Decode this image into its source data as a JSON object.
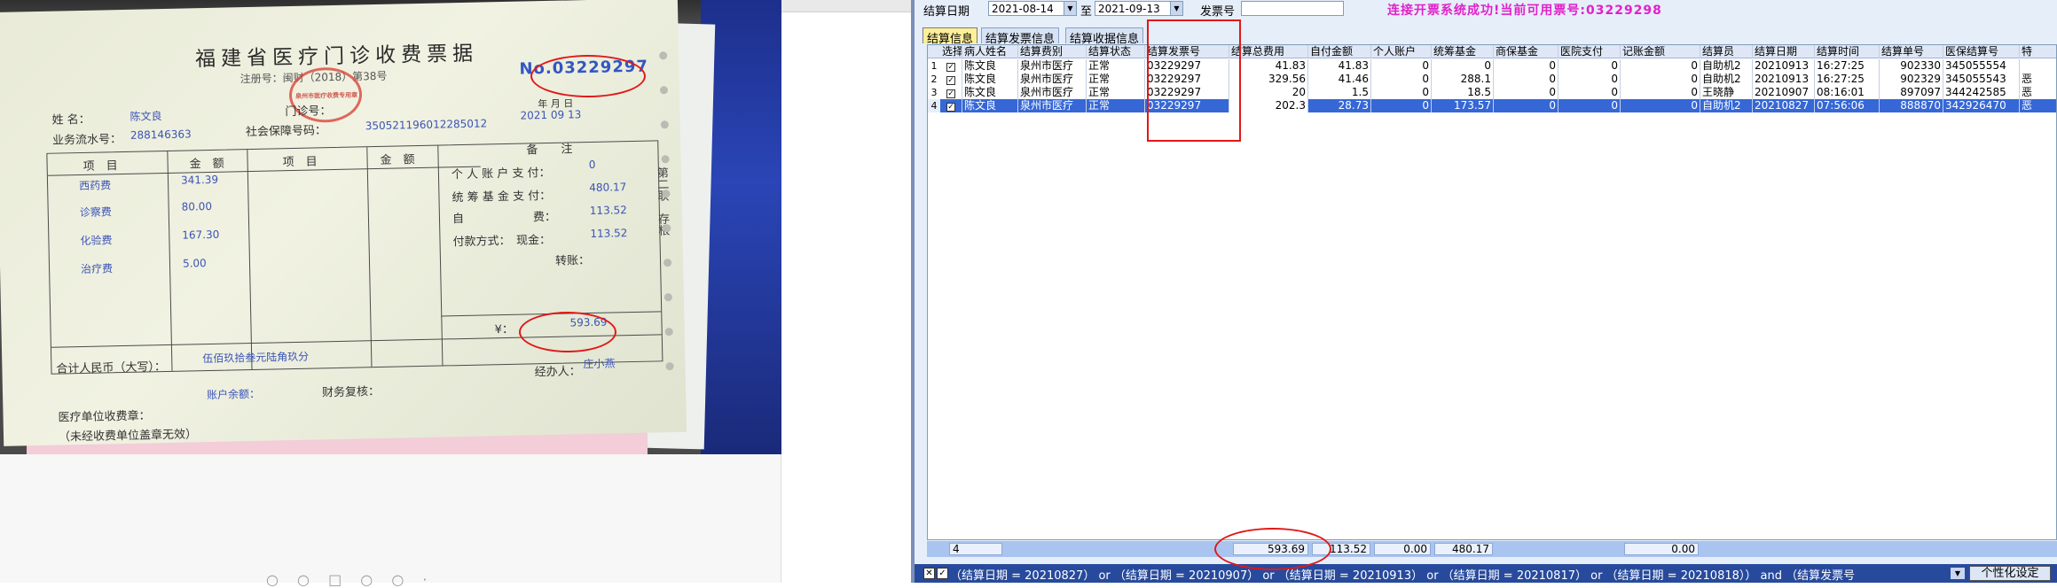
{
  "receipt_photo": {
    "title": "福建省医疗门诊收费票据",
    "registration": "注册号：闽财（2018）第38号",
    "number": "No.03229297",
    "name_label": "姓 名：",
    "name_value": "陈文良",
    "clinic_no_label": "门诊号：",
    "serial_label": "业务流水号：",
    "serial_value": "288146363",
    "ssn_label": "社会保障号码：",
    "ssn_value": "350521196012285012",
    "date_value": "2021    09    13",
    "date_units": "年    月    日",
    "table_headers": [
      "项　目",
      "金　额",
      "项　目",
      "金　额",
      "备　　注"
    ],
    "items": [
      {
        "name": "西药费",
        "amount": "341.39"
      },
      {
        "name": "诊察费",
        "amount": "80.00"
      },
      {
        "name": "化验费",
        "amount": "167.30"
      },
      {
        "name": "治疗费",
        "amount": "5.00"
      }
    ],
    "notes": [
      {
        "label": "个 人 账 户 支 付：",
        "value": "0"
      },
      {
        "label": "统 筹 基 金 支 付：",
        "value": "480.17"
      },
      {
        "label": "自　　　　　　费：",
        "value": "113.52"
      },
      {
        "label": "付款方式：　现金：",
        "value": "113.52"
      },
      {
        "label": "转账：",
        "value": ""
      }
    ],
    "total_symbol": "¥：",
    "total_value": "593.69",
    "upper_label": "合计人民币（大写）：",
    "upper_value": "伍佰玖拾叁元陆角玖分",
    "balance_label": "账户余额：",
    "review_label": "财务复核：",
    "handler_label": "经办人：",
    "handler_value": "庄小燕",
    "footer1": "医疗单位收费章：",
    "footer2": "（未经收费单位盖章无效）",
    "side_text": "第二联　存根",
    "stamp_text": "泉州市医疗收费专用章"
  },
  "app": {
    "filter": {
      "date_label": "结算日期",
      "date_from": "2021-08-14",
      "to_label": "至",
      "date_to": "2021-09-13",
      "invoice_label": "发票号",
      "invoice_value": ""
    },
    "status_message": "连接开票系统成功!当前可用票号:03229298",
    "tabs": [
      "结算信息",
      "结算发票信息",
      "结算收据信息"
    ],
    "columns": [
      "选择",
      "病人姓名",
      "结算费别",
      "结算状态",
      "结算发票号",
      "结算总费用",
      "自付金额",
      "个人账户",
      "统筹基金",
      "商保基金",
      "医院支付",
      "记账金额",
      "结算员",
      "结算日期",
      "结算时间",
      "结算单号",
      "医保结算号",
      "特"
    ],
    "rows": [
      {
        "no": "1",
        "checked": "✓",
        "cells": [
          "陈文良",
          "泉州市医疗",
          "正常",
          "03229297",
          "41.83",
          "41.83",
          "0",
          "0",
          "0",
          "0",
          "0",
          "自助机2",
          "20210913",
          "16:27:25",
          "902330",
          "345055554",
          ""
        ]
      },
      {
        "no": "2",
        "checked": "✓",
        "cells": [
          "陈文良",
          "泉州市医疗",
          "正常",
          "03229297",
          "329.56",
          "41.46",
          "0",
          "288.1",
          "0",
          "0",
          "0",
          "自助机2",
          "20210913",
          "16:27:25",
          "902329",
          "345055543",
          "恶"
        ]
      },
      {
        "no": "3",
        "checked": "✓",
        "cells": [
          "陈文良",
          "泉州市医疗",
          "正常",
          "03229297",
          "20",
          "1.5",
          "0",
          "18.5",
          "0",
          "0",
          "0",
          "王晓静",
          "20210907",
          "08:16:01",
          "897097",
          "344242585",
          "恶"
        ]
      },
      {
        "no": "4",
        "checked": "✓",
        "cells": [
          "陈文良",
          "泉州市医疗",
          "正常",
          "03229297",
          "202.3",
          "28.73",
          "0",
          "173.57",
          "0",
          "0",
          "0",
          "自助机2",
          "20210827",
          "07:56:06",
          "888870",
          "342926470",
          "恶"
        ]
      }
    ],
    "totals": {
      "count": "4",
      "total_fee": "593.69",
      "self_pay": "113.52",
      "personal_account": "0.00",
      "pooled_fund": "480.17",
      "hospital_bill": "0.00"
    },
    "query_text": "（结算日期 = 20210827） or （结算日期 = 20210907） or （结算日期 = 20210913） or （结算日期 = 20210817） or （结算日期 = 20210818）） and （结算发票号",
    "personalize_button": "个性化设定",
    "colors": {
      "window_bg": "#e6eefa",
      "selected_row": "#3567d6",
      "status_text": "#e021c8",
      "annotation_red": "#e01818",
      "query_bar": "#274a9c"
    }
  }
}
